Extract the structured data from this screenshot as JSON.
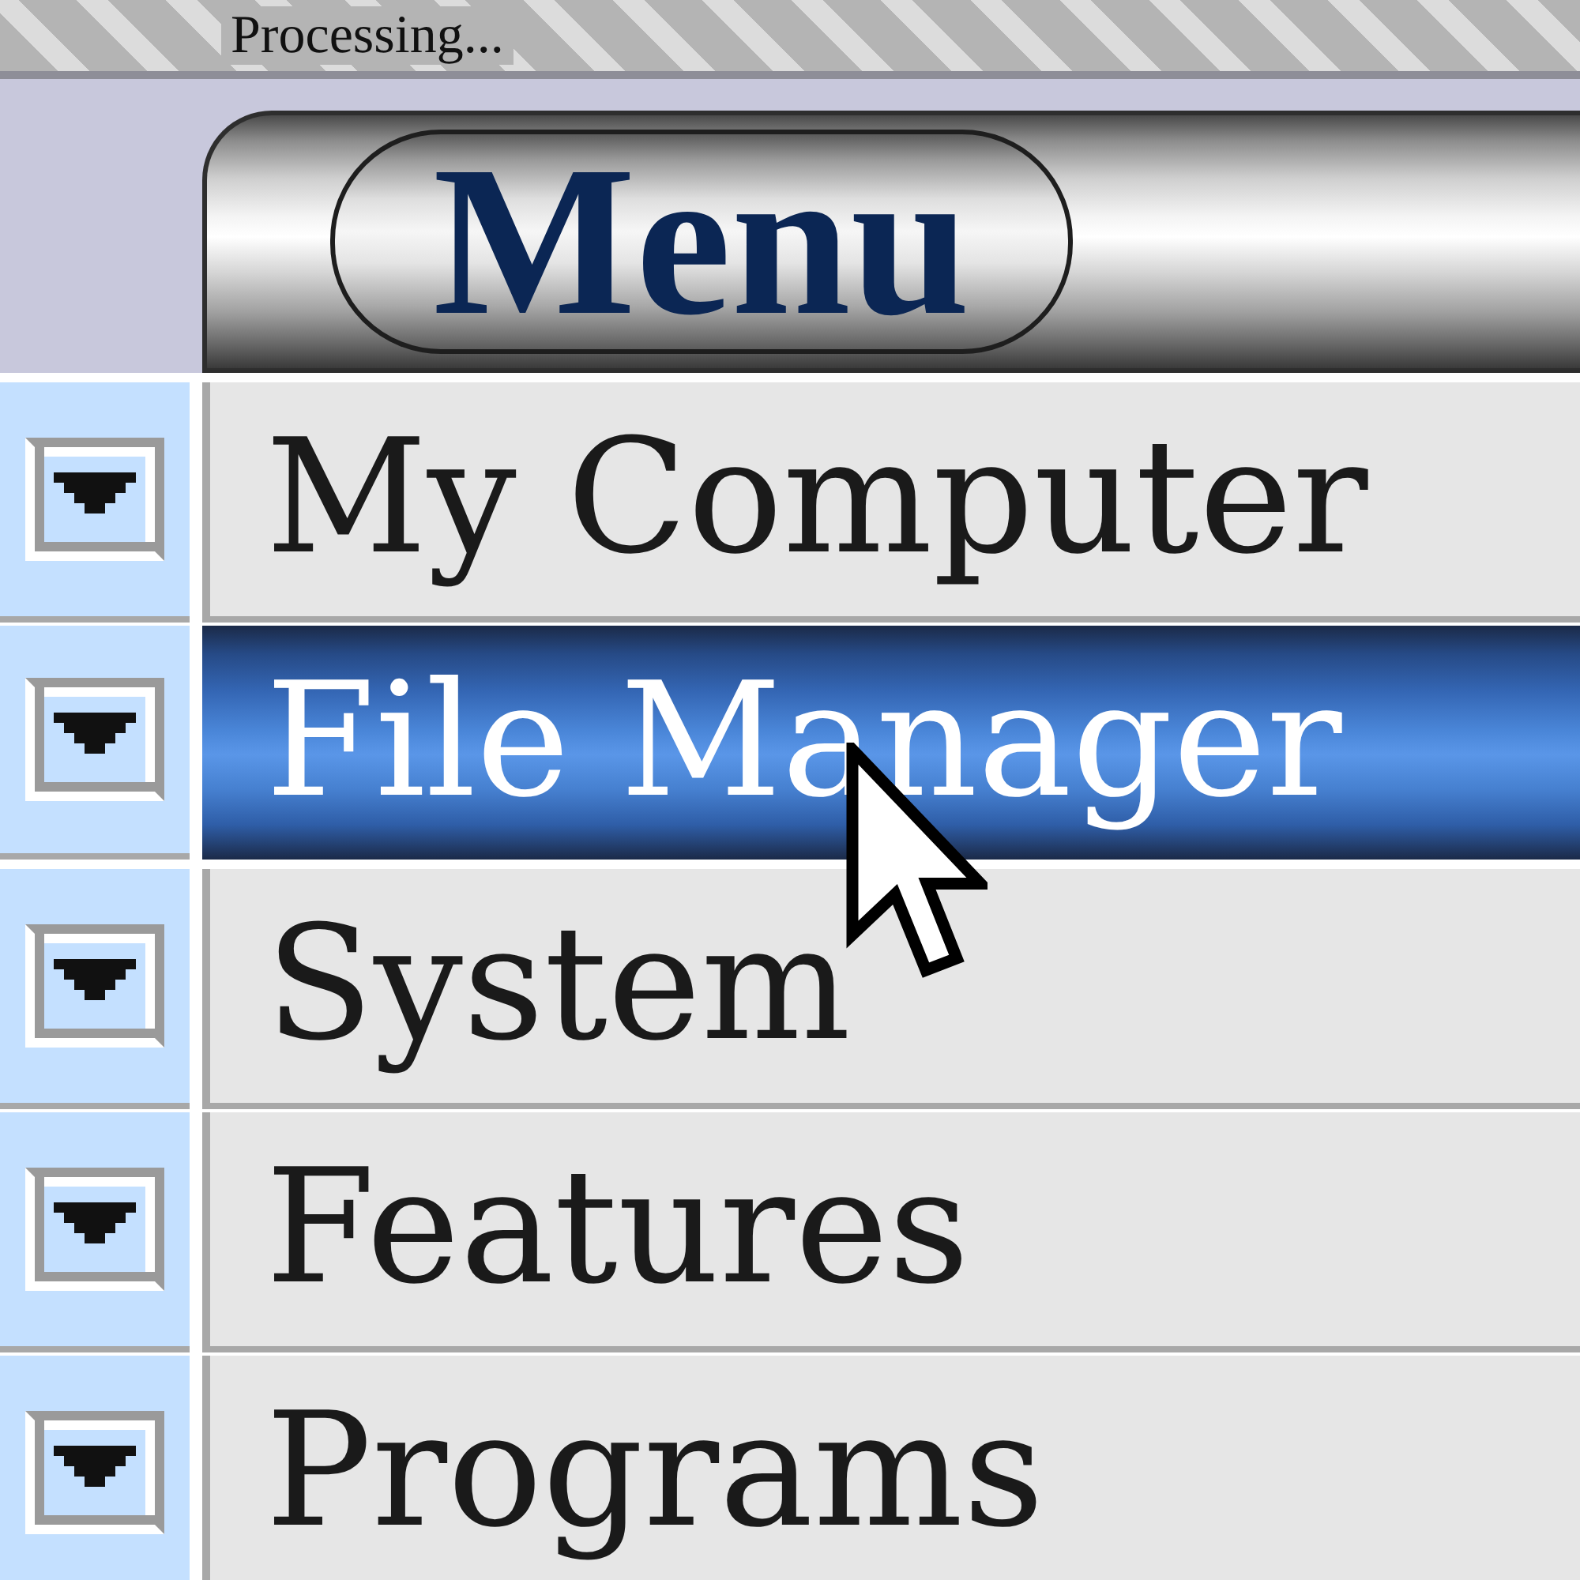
{
  "status_bar": {
    "text": "Processing..."
  },
  "menu_header": {
    "button": "Menu"
  },
  "items": [
    {
      "label": "My Computer",
      "selected": false
    },
    {
      "label": "File Manager",
      "selected": true
    },
    {
      "label": "System",
      "selected": false
    },
    {
      "label": "Features",
      "selected": false
    },
    {
      "label": "Programs",
      "selected": false
    }
  ]
}
